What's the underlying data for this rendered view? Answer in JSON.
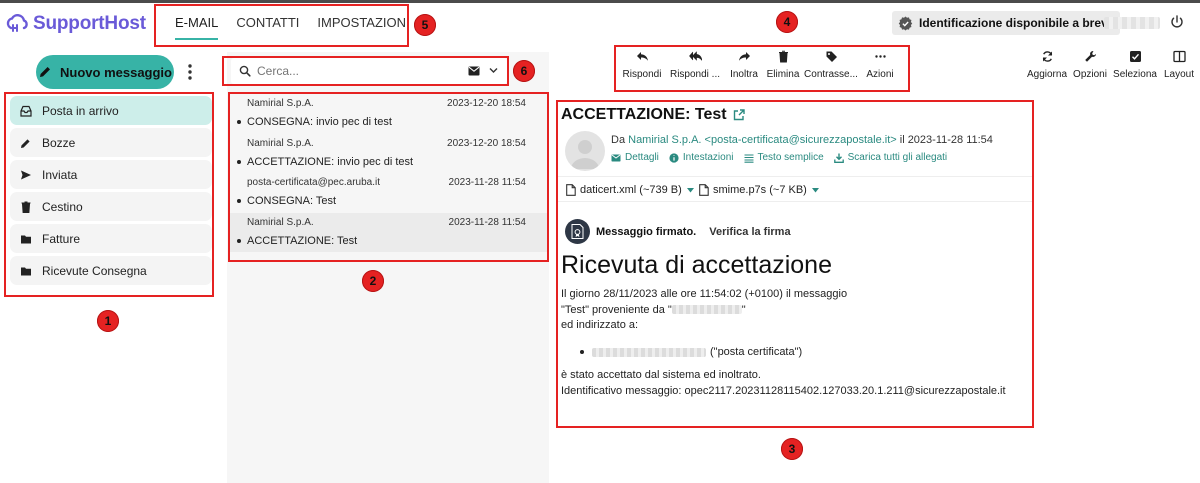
{
  "brand": {
    "name": "SupportHost",
    "color": "#6a5ad8",
    "accent": "#37b3a6",
    "annotation_color": "#e52222"
  },
  "nav": {
    "tabs": [
      {
        "label": "E-MAIL"
      },
      {
        "label": "CONTATTI"
      },
      {
        "label": "IMPOSTAZIONI"
      }
    ],
    "active": "E-MAIL"
  },
  "header": {
    "identity_notice": "Identificazione disponibile a breve"
  },
  "compose": {
    "label": "Nuovo messaggio"
  },
  "folders": [
    {
      "label": "Posta in arrivo",
      "icon": "inbox-icon",
      "active": true
    },
    {
      "label": "Bozze",
      "icon": "pencil-icon"
    },
    {
      "label": "Inviata",
      "icon": "send-icon"
    },
    {
      "label": "Cestino",
      "icon": "trash-icon"
    },
    {
      "label": "Fatture",
      "icon": "folder-icon"
    },
    {
      "label": "Ricevute Consegna",
      "icon": "folder-icon"
    }
  ],
  "search": {
    "placeholder": "Cerca..."
  },
  "messages": [
    {
      "from": "Namirial S.p.A.",
      "date": "2023-12-20 18:54",
      "subject": "CONSEGNA: invio pec di test"
    },
    {
      "from": "Namirial S.p.A.",
      "date": "2023-12-20 18:54",
      "subject": "ACCETTAZIONE: invio pec di test"
    },
    {
      "from": "posta-certificata@pec.aruba.it",
      "date": "2023-11-28 11:54",
      "subject": "CONSEGNA: Test"
    },
    {
      "from": "Namirial S.p.A.",
      "date": "2023-11-28 11:54",
      "subject": "ACCETTAZIONE: Test",
      "selected": true
    }
  ],
  "toolbar": {
    "reply": "Rispondi",
    "reply_all": "Rispondi ...",
    "forward": "Inoltra",
    "delete": "Elimina",
    "mark": "Contrasse...",
    "actions": "Azioni",
    "refresh": "Aggiorna",
    "options": "Opzioni",
    "select": "Seleziona",
    "layout": "Layout"
  },
  "reader": {
    "title": "ACCETTAZIONE: Test",
    "from_prefix": "Da",
    "from": "Namirial S.p.A. <posta-certificata@sicurezzapostale.it>",
    "date_text": "il 2023-11-28 11:54",
    "links": {
      "details": "Dettagli",
      "headers": "Intestazioni",
      "plain": "Testo semplice",
      "download_all": "Scarica tutti gli allegati"
    },
    "attachments": [
      {
        "name": "daticert.xml (~739 B)"
      },
      {
        "name": "smime.p7s (~7 KB)"
      }
    ],
    "signed": "Messaggio firmato.",
    "verify": "Verifica la firma",
    "heading": "Ricevuta di accettazione",
    "line1": "Il giorno 28/11/2023 alle ore 11:54:02 (+0100) il messaggio",
    "line2a": "\"Test\" proveniente da \"",
    "line2b": "\"",
    "line3": "ed indirizzato a:",
    "bullet_suffix": "(\"posta certificata\")",
    "line4": "è stato accettato dal sistema ed inoltrato.",
    "line5": "Identificativo messaggio: opec2117.20231128115402.127033.20.1.211@sicurezzapostale.it"
  },
  "annotations": [
    "1",
    "2",
    "3",
    "4",
    "5",
    "6"
  ]
}
